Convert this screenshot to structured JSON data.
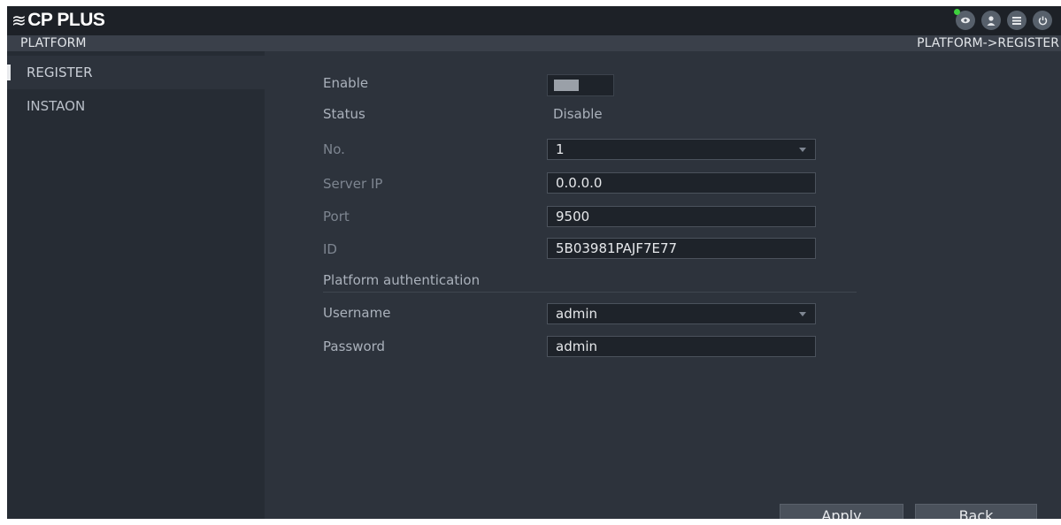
{
  "header": {
    "logo_text": "CP PLUS",
    "icons": [
      "network-icon",
      "user-icon",
      "menu-grid-icon",
      "power-icon"
    ]
  },
  "breadcrumb": {
    "section": "PLATFORM",
    "path": "PLATFORM->REGISTER"
  },
  "sidebar": {
    "items": [
      {
        "label": "REGISTER",
        "active": true
      },
      {
        "label": "INSTAON",
        "active": false
      }
    ]
  },
  "form": {
    "enable_label": "Enable",
    "enable_on": false,
    "status_label": "Status",
    "status_value": "Disable",
    "no_label": "No.",
    "no_value": "1",
    "server_ip_label": "Server IP",
    "server_ip_value": "0.0.0.0",
    "port_label": "Port",
    "port_value": "9500",
    "id_label": "ID",
    "id_value": "5B03981PAJF7E77",
    "auth_section": "Platform authentication",
    "username_label": "Username",
    "username_value": "admin",
    "password_label": "Password",
    "password_value": "admin"
  },
  "buttons": {
    "apply": "Apply",
    "back": "Back"
  }
}
